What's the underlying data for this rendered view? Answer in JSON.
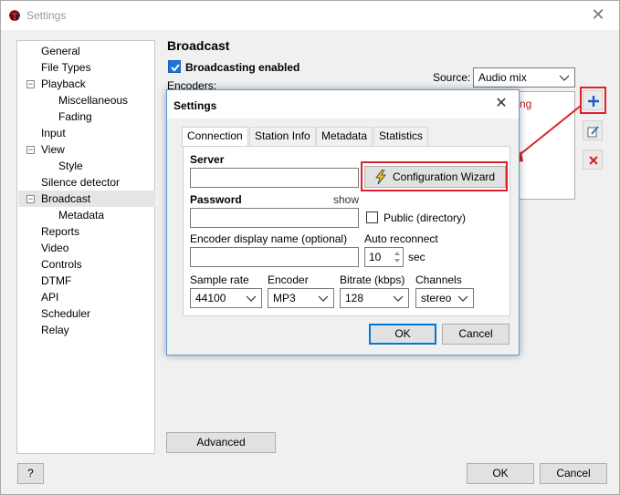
{
  "window": {
    "title": "Settings",
    "close_symbol": "✕"
  },
  "tree": {
    "items": [
      {
        "label": "General",
        "level": 0,
        "expander": ""
      },
      {
        "label": "File Types",
        "level": 0,
        "expander": ""
      },
      {
        "label": "Playback",
        "level": 0,
        "expander": "−"
      },
      {
        "label": "Miscellaneous",
        "level": 1,
        "expander": ""
      },
      {
        "label": "Fading",
        "level": 1,
        "expander": ""
      },
      {
        "label": "Input",
        "level": 0,
        "expander": ""
      },
      {
        "label": "View",
        "level": 0,
        "expander": "−"
      },
      {
        "label": "Style",
        "level": 1,
        "expander": ""
      },
      {
        "label": "Silence detector",
        "level": 0,
        "expander": ""
      },
      {
        "label": "Broadcast",
        "level": 0,
        "expander": "−",
        "selected": true
      },
      {
        "label": "Metadata",
        "level": 1,
        "expander": ""
      },
      {
        "label": "Reports",
        "level": 0,
        "expander": ""
      },
      {
        "label": "Video",
        "level": 0,
        "expander": ""
      },
      {
        "label": "Controls",
        "level": 0,
        "expander": ""
      },
      {
        "label": "DTMF",
        "level": 0,
        "expander": ""
      },
      {
        "label": "API",
        "level": 0,
        "expander": ""
      },
      {
        "label": "Scheduler",
        "level": 0,
        "expander": ""
      },
      {
        "label": "Relay",
        "level": 0,
        "expander": ""
      }
    ]
  },
  "broadcast": {
    "title": "Broadcast",
    "enabled_label": "Broadcasting enabled",
    "enabled": true,
    "encoders_label": "Encoders:",
    "source_label": "Source:",
    "source_value": "Audio mix",
    "encoder_list_partial_text": "ng",
    "advanced_label": "Advanced"
  },
  "dialog": {
    "title": "Settings",
    "close_symbol": "✕",
    "tabs": [
      "Connection",
      "Station Info",
      "Metadata",
      "Statistics"
    ],
    "active_tab": 0,
    "server_label": "Server",
    "server_value": "",
    "wizard_label": "Configuration Wizard",
    "password_label": "Password",
    "show_label": "show",
    "password_value": "",
    "public_label": "Public (directory)",
    "public_checked": false,
    "display_name_label": "Encoder display name (optional)",
    "display_name_value": "",
    "auto_reconnect_label": "Auto reconnect",
    "auto_reconnect_value": "10",
    "auto_reconnect_unit": "sec",
    "sample_rate_label": "Sample rate",
    "sample_rate_value": "44100",
    "encoder_label": "Encoder",
    "encoder_value": "MP3",
    "bitrate_label": "Bitrate (kbps)",
    "bitrate_value": "128",
    "channels_label": "Channels",
    "channels_value": "stereo",
    "ok_label": "OK",
    "cancel_label": "Cancel"
  },
  "footer": {
    "help_label": "?",
    "ok_label": "OK",
    "cancel_label": "Cancel"
  },
  "colors": {
    "accent": "#0078d7",
    "highlight": "#e0202a",
    "check": "#1a73d9"
  }
}
